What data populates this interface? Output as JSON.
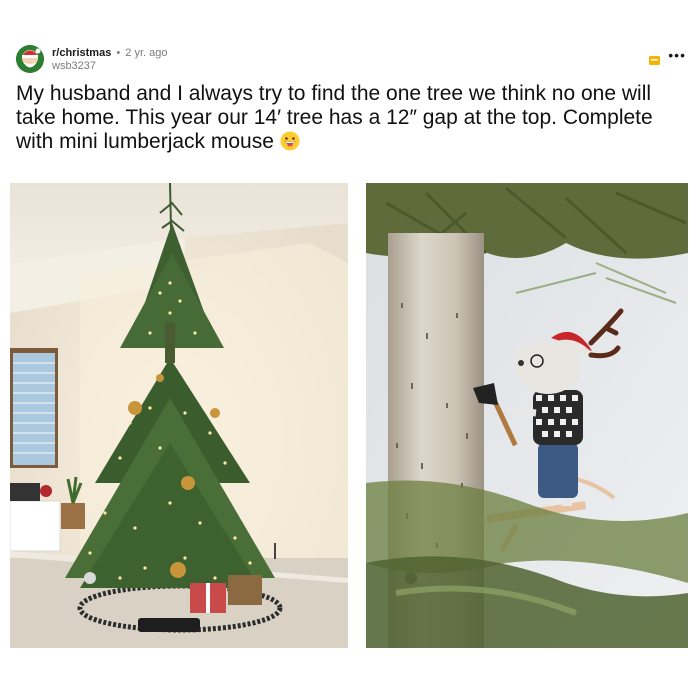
{
  "post": {
    "subreddit": "r/christmas",
    "age": "2 yr. ago",
    "username": "wsb3237",
    "title": "My husband and I always try to find the one tree we think no one will take home. This year our 14′ tree has a 12″ gap at the top. Complete with mini lumberjack mouse",
    "more_label": "•••"
  },
  "icons": {
    "avatar": "subreddit-avatar-icon",
    "award": "award-icon",
    "more": "more-options-icon",
    "emoji": "grinning-face-emoji-icon"
  },
  "colors": {
    "accent_award": "#f5b400",
    "avatar_bg": "#2e7d32"
  }
}
